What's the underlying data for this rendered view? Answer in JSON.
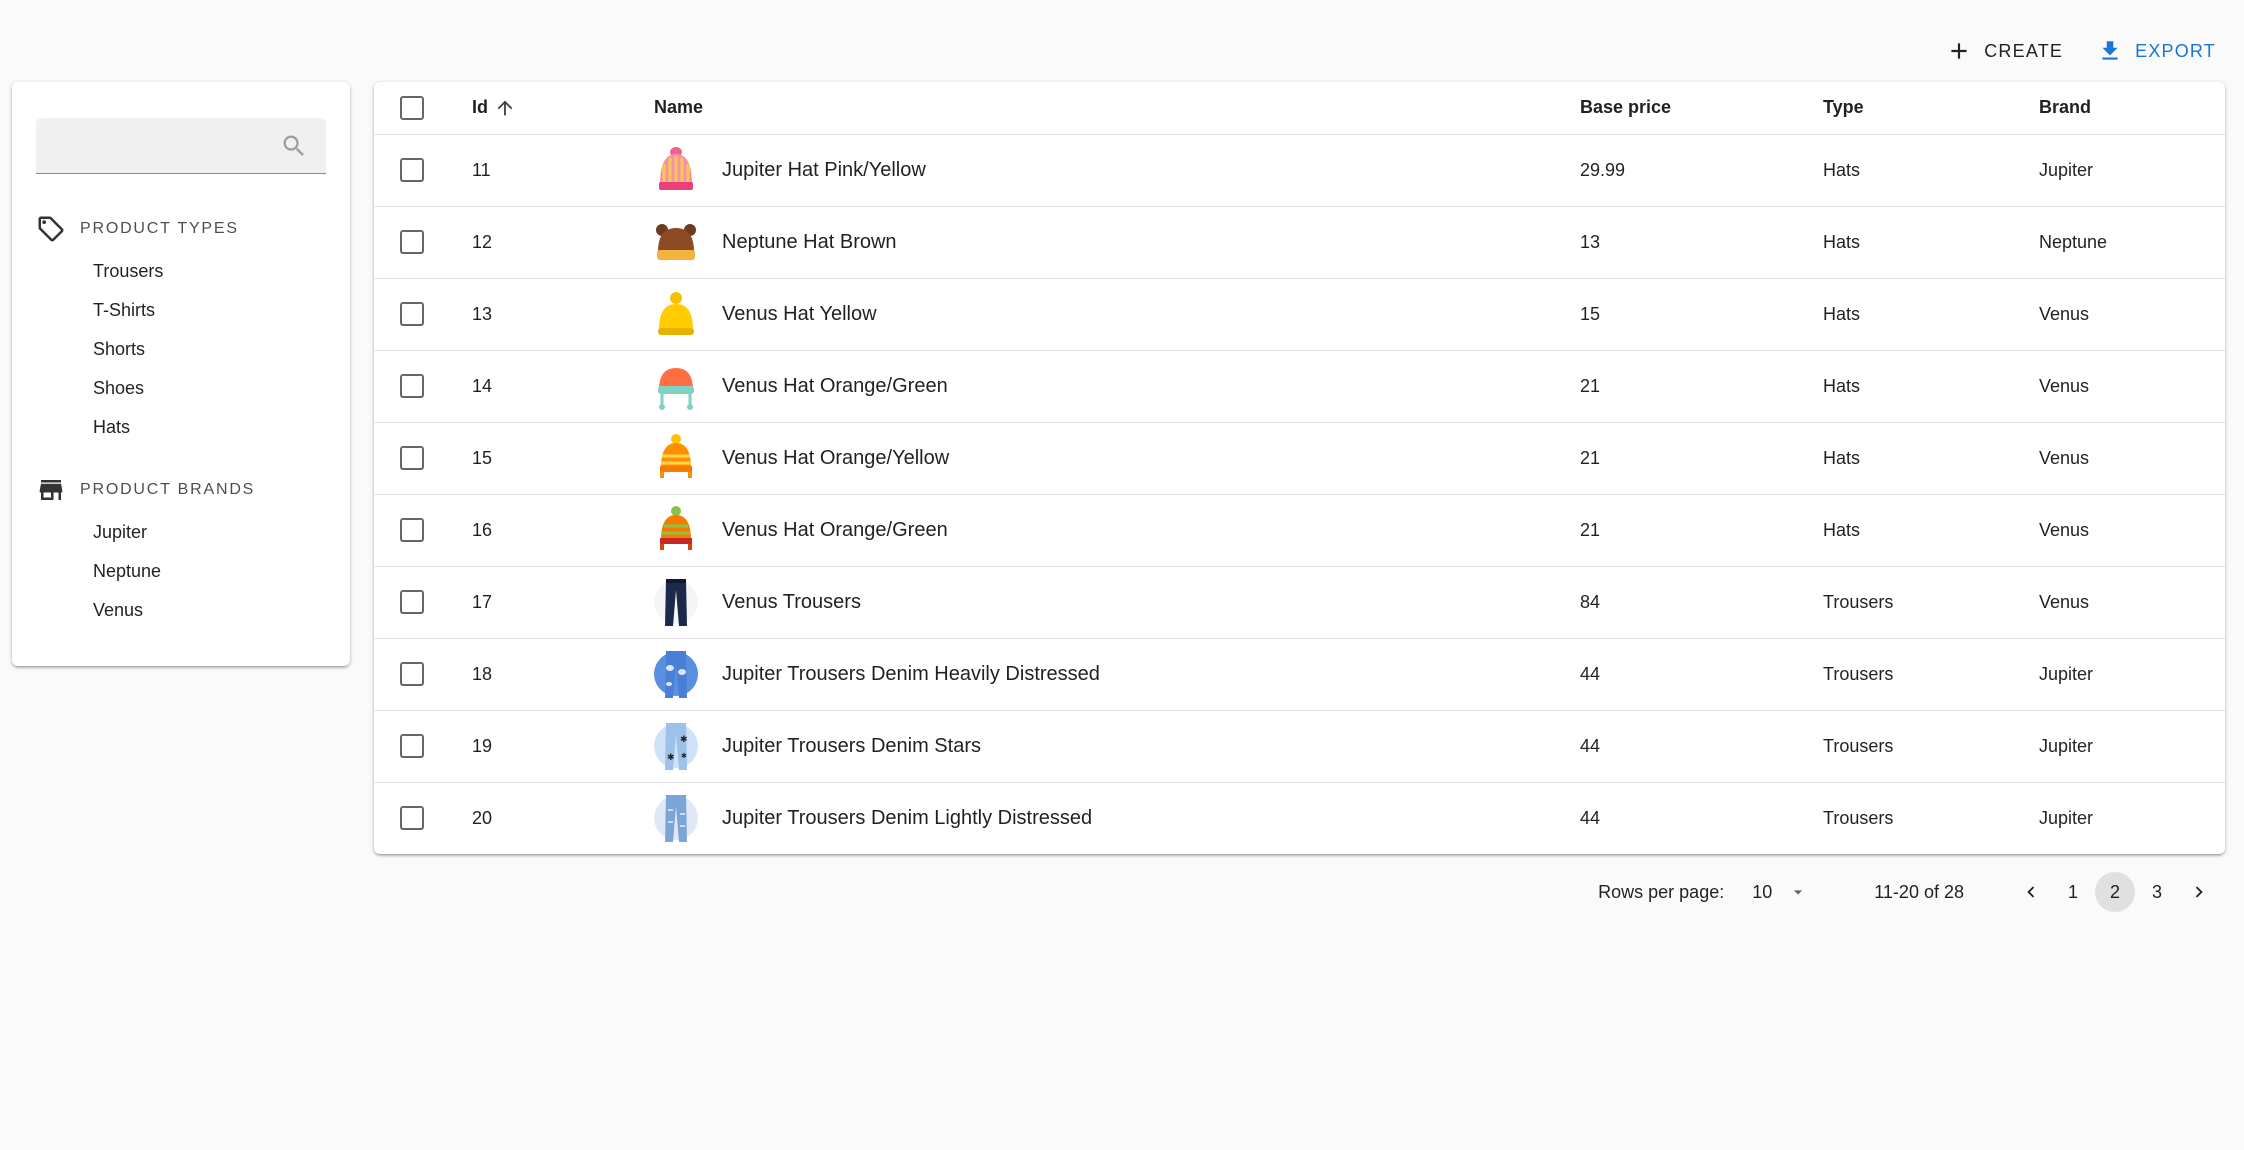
{
  "toolbar": {
    "create_label": "CREATE",
    "export_label": "EXPORT",
    "accent_color": "#1976d2"
  },
  "sidebar": {
    "search": {
      "placeholder": "",
      "value": ""
    },
    "product_types": {
      "heading": "PRODUCT TYPES",
      "icon": "tag-icon",
      "items": [
        "Trousers",
        "T-Shirts",
        "Shorts",
        "Shoes",
        "Hats"
      ]
    },
    "product_brands": {
      "heading": "PRODUCT BRANDS",
      "icon": "store-icon",
      "items": [
        "Jupiter",
        "Neptune",
        "Venus"
      ]
    }
  },
  "table": {
    "headers": {
      "id": "Id",
      "name": "Name",
      "base_price": "Base price",
      "type": "Type",
      "brand": "Brand"
    },
    "sort": {
      "column": "id",
      "direction": "asc"
    },
    "rows": [
      {
        "id": "11",
        "name": "Jupiter Hat Pink/Yellow",
        "price": "29.99",
        "type": "Hats",
        "brand": "Jupiter",
        "thumb": "hat-pink-yellow"
      },
      {
        "id": "12",
        "name": "Neptune Hat Brown",
        "price": "13",
        "type": "Hats",
        "brand": "Neptune",
        "thumb": "hat-brown-bear"
      },
      {
        "id": "13",
        "name": "Venus Hat Yellow",
        "price": "15",
        "type": "Hats",
        "brand": "Venus",
        "thumb": "hat-yellow"
      },
      {
        "id": "14",
        "name": "Venus Hat Orange/Green",
        "price": "21",
        "type": "Hats",
        "brand": "Venus",
        "thumb": "hat-orange-teal"
      },
      {
        "id": "15",
        "name": "Venus Hat Orange/Yellow",
        "price": "21",
        "type": "Hats",
        "brand": "Venus",
        "thumb": "hat-orange-yellow"
      },
      {
        "id": "16",
        "name": "Venus Hat Orange/Green",
        "price": "21",
        "type": "Hats",
        "brand": "Venus",
        "thumb": "hat-orange-green"
      },
      {
        "id": "17",
        "name": "Venus Trousers",
        "price": "84",
        "type": "Trousers",
        "brand": "Venus",
        "thumb": "trousers-dark"
      },
      {
        "id": "18",
        "name": "Jupiter Trousers Denim Heavily Distressed",
        "price": "44",
        "type": "Trousers",
        "brand": "Jupiter",
        "thumb": "trousers-denim-heavy"
      },
      {
        "id": "19",
        "name": "Jupiter Trousers Denim Stars",
        "price": "44",
        "type": "Trousers",
        "brand": "Jupiter",
        "thumb": "trousers-denim-stars"
      },
      {
        "id": "20",
        "name": "Jupiter Trousers Denim Lightly Distressed",
        "price": "44",
        "type": "Trousers",
        "brand": "Jupiter",
        "thumb": "trousers-denim-light"
      }
    ]
  },
  "pagination": {
    "rows_per_page_label": "Rows per page:",
    "rows_per_page": "10",
    "range": "11-20 of 28",
    "pages": [
      "1",
      "2",
      "3"
    ],
    "current_page": "2"
  }
}
